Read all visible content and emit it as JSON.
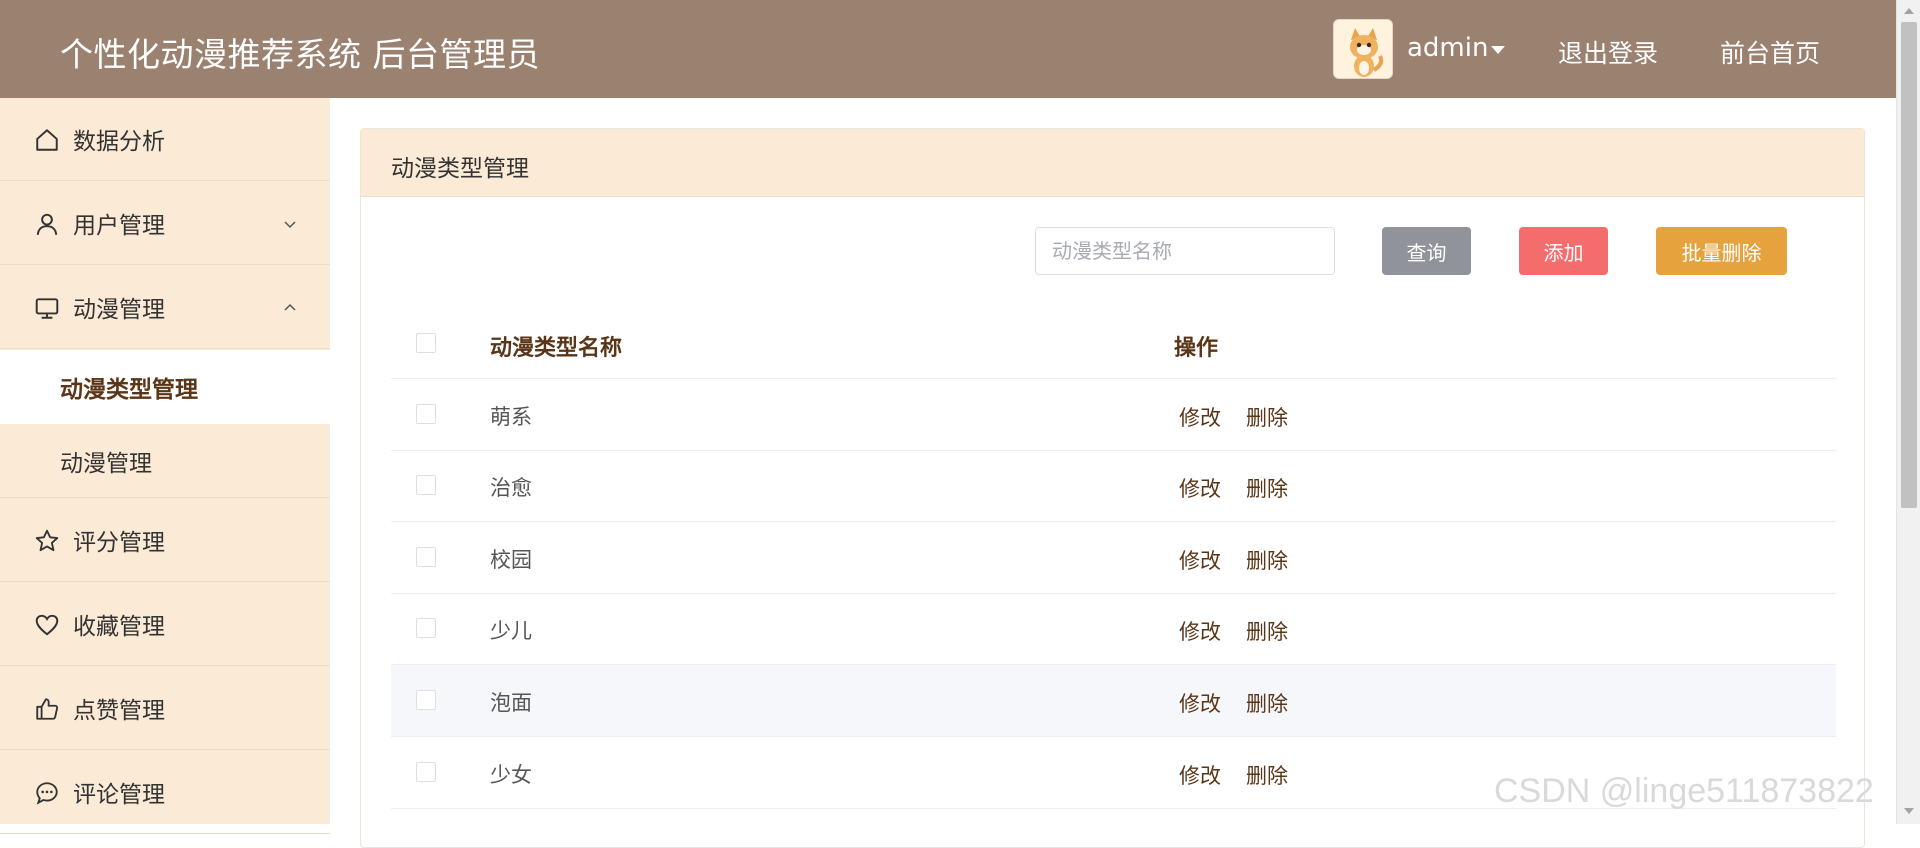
{
  "header": {
    "title": "个性化动漫推荐系统 后台管理员",
    "username": "admin",
    "logout_label": "退出登录",
    "home_label": "前台首页"
  },
  "sidebar": {
    "items": [
      {
        "label": "数据分析",
        "icon": "home-icon"
      },
      {
        "label": "用户管理",
        "icon": "user-icon",
        "chevron": "chevron-down-icon"
      },
      {
        "label": "动漫管理",
        "icon": "monitor-icon",
        "chevron": "chevron-up-icon"
      },
      {
        "label": "评分管理",
        "icon": "star-icon"
      },
      {
        "label": "收藏管理",
        "icon": "heart-icon"
      },
      {
        "label": "点赞管理",
        "icon": "thumbs-up-icon"
      },
      {
        "label": "评论管理",
        "icon": "comment-icon"
      }
    ],
    "subitems": [
      {
        "label": "动漫类型管理",
        "active": true
      },
      {
        "label": "动漫管理",
        "active": false
      }
    ]
  },
  "panel": {
    "title": "动漫类型管理",
    "search_placeholder": "动漫类型名称",
    "query_label": "查询",
    "add_label": "添加",
    "batch_delete_label": "批量删除"
  },
  "table": {
    "col_name": "动漫类型名称",
    "col_ops": "操作",
    "edit_label": "修改",
    "delete_label": "删除",
    "rows": [
      "萌系",
      "治愈",
      "校园",
      "少儿",
      "泡面",
      "少女"
    ]
  },
  "watermark": "CSDN @linge511873822",
  "colors": {
    "header_bg": "#9b8170",
    "sidebar_bg": "#fbead5",
    "accent_text": "#5a3517",
    "query_btn": "#909399",
    "add_btn": "#f56c6c",
    "batch_btn": "#e6a23c"
  }
}
